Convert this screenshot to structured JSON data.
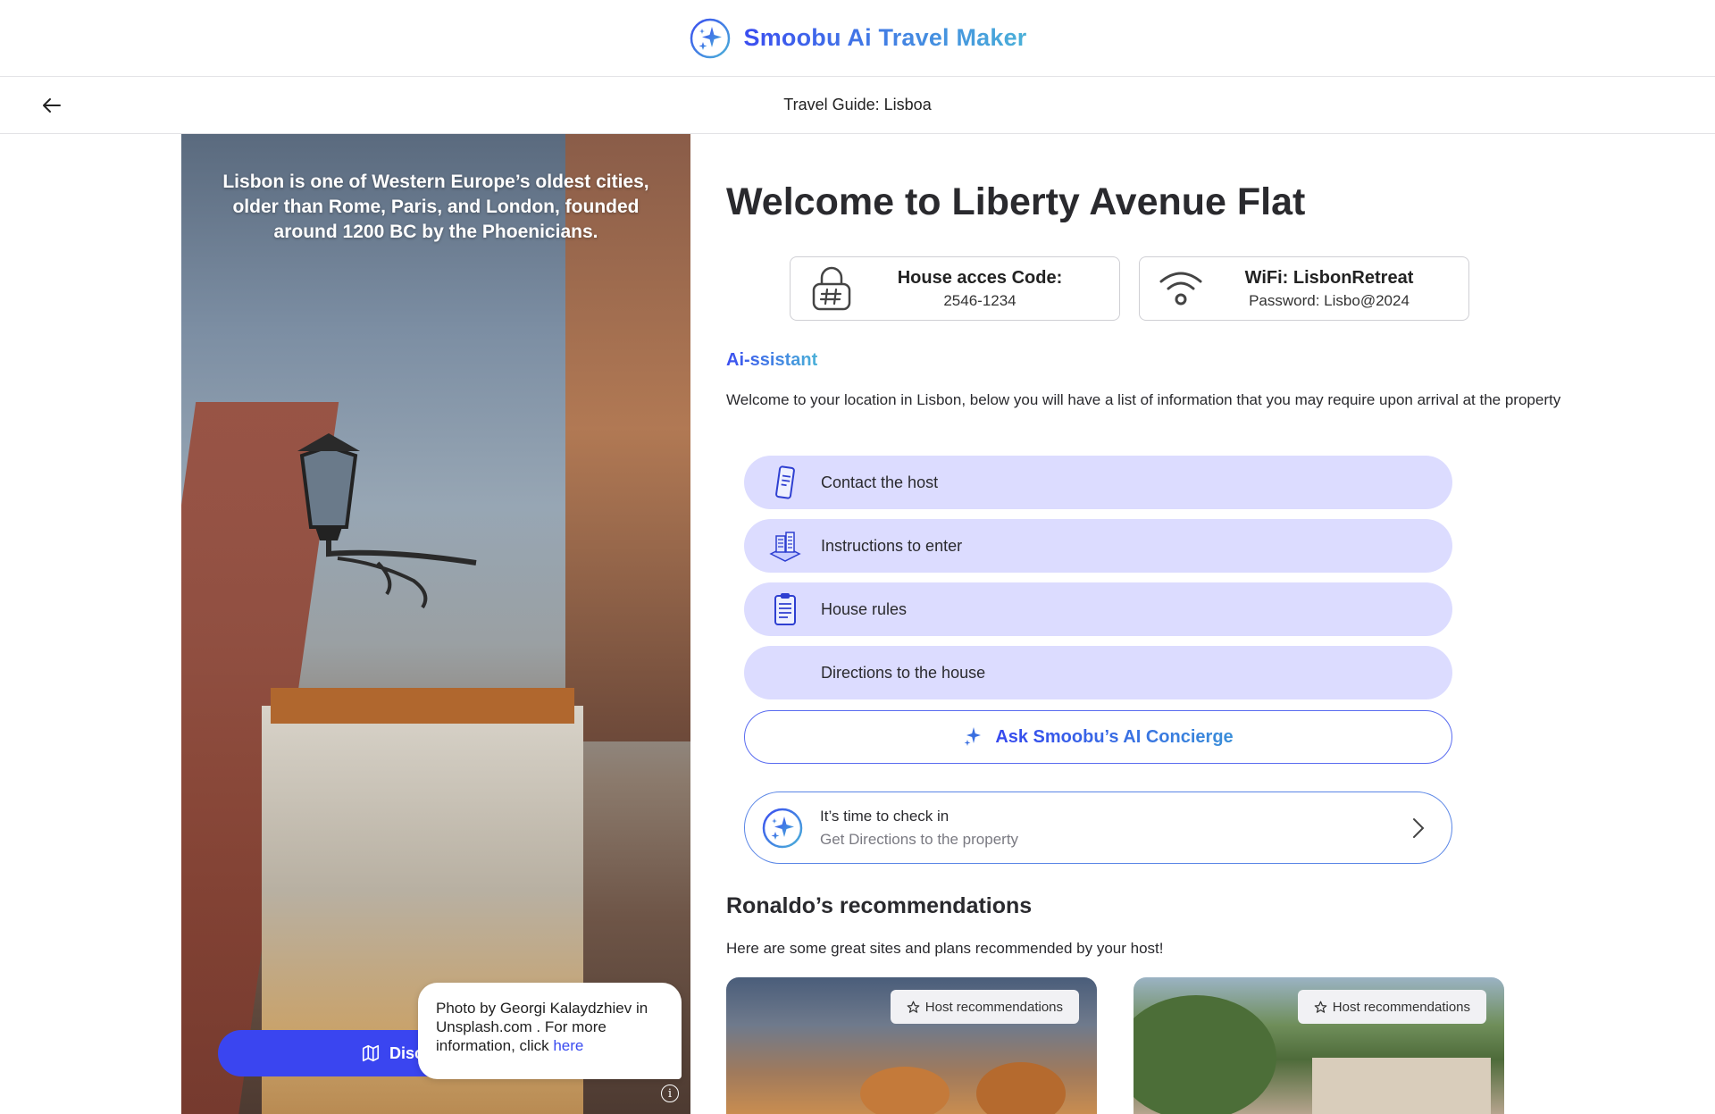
{
  "header": {
    "brand": "Smoobu Ai Travel Maker",
    "page_title": "Travel Guide: Lisboa"
  },
  "hero": {
    "quote": "Lisbon is one of Western Europe’s oldest cities, older than Rome, Paris, and London, founded around 1200 BC by the Phoenicians.",
    "discover_label": "Disc",
    "tooltip_text": "Photo by Georgi Kalaydzhiev in Unsplash.com . For more information, click ",
    "tooltip_link": "here",
    "info_glyph": "i"
  },
  "main": {
    "welcome": "Welcome to Liberty Avenue Flat",
    "access_card": {
      "title": "House acces Code:",
      "value": "2546-1234"
    },
    "wifi_card": {
      "title": "WiFi: LisbonRetreat",
      "value": "Password: Lisbo@2024"
    },
    "ai_label": "Ai-ssistant",
    "intro": "Welcome to your location in Lisbon, below you will have a list of information that you may require upon arrival at the property",
    "menu": [
      {
        "label": "Contact the host",
        "icon": "phone-icon"
      },
      {
        "label": "Instructions to enter",
        "icon": "building-icon"
      },
      {
        "label": "House rules",
        "icon": "clipboard-icon"
      },
      {
        "label": "Directions to the house",
        "icon": ""
      }
    ],
    "ask_label": "Ask Smoobu’s AI Concierge",
    "checkin": {
      "title": "It’s time to check in",
      "subtitle": "Get Directions to the property"
    },
    "recommendations": {
      "title": "Ronaldo’s recommendations",
      "subtitle": "Here are some great sites and plans recommended by your host!",
      "cards": [
        {
          "badge": "Host recommendations"
        },
        {
          "badge": "Host recommendations"
        }
      ]
    }
  },
  "colors": {
    "accent": "#3a45f0",
    "menu_bg": "#dcdcff",
    "gradient_end": "#4ab0d8"
  }
}
